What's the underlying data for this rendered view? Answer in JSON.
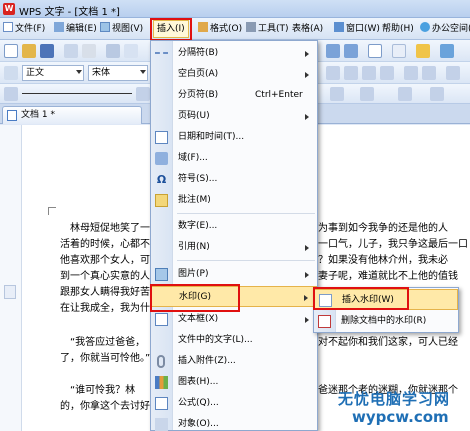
{
  "window": {
    "title": "WPS 文字 - [文档 1 *]"
  },
  "menubar": {
    "items": [
      {
        "label": "文件(F)"
      },
      {
        "label": "编辑(E)"
      },
      {
        "label": "视图(V)"
      },
      {
        "label": "插入(I)"
      },
      {
        "label": "格式(O)"
      },
      {
        "label": "工具(T)"
      },
      {
        "label": "表格(A)"
      },
      {
        "label": "窗口(W)"
      },
      {
        "label": "帮助(H)"
      },
      {
        "label": "办公空间("
      }
    ]
  },
  "toolbar": {
    "style_value": "正文",
    "font_value": "宋体"
  },
  "tabs": {
    "doc_label": "文档 1 *"
  },
  "insert_menu": {
    "items": [
      {
        "label": "分隔符(B)"
      },
      {
        "label": "空白页(A)"
      },
      {
        "label": "分页符(B)",
        "shortcut": "Ctrl+Enter"
      },
      {
        "label": "页码(U)"
      },
      {
        "label": "日期和时间(T)..."
      },
      {
        "label": "域(F)..."
      },
      {
        "label": "符号(S)..."
      },
      {
        "label": "批注(M)"
      },
      {
        "label": "数字(E)..."
      },
      {
        "label": "引用(N)"
      },
      {
        "label": "图片(P)"
      },
      {
        "label": "水印(G)"
      },
      {
        "label": "文本框(X)"
      },
      {
        "label": "文件中的文字(L)..."
      },
      {
        "label": "插入附件(Z)..."
      },
      {
        "label": "图表(H)..."
      },
      {
        "label": "公式(Q)..."
      },
      {
        "label": "对象(O)..."
      }
    ]
  },
  "watermark_submenu": {
    "items": [
      {
        "label": "插入水印(W)"
      },
      {
        "label": "删除文档中的水印(R)"
      }
    ]
  },
  "document": {
    "lines_left": [
      "林母短促地笑了一",
      "活着的时候，心都不",
      "他喜欢那个女人，可",
      "到一个真心实意的人",
      "跟那女人瞒得我好苦",
      "在让我成全，我为什"
    ],
    "lines_right": [
      "为事到如今我争的还是他的人",
      "一口气，儿子，我只争这最后一口",
      "？如果没有他林介州，我未必",
      "妻子呢，难道就比不上他的值钱",
      "",
      ""
    ],
    "para2_left": [
      "“我答应过爸爸，",
      "了，你就当可怜他。”"
    ],
    "para2_right": [
      "对不起你和我们这家，可人已经",
      ""
    ],
    "para3_left": [
      "“谁可怜我？林",
      "的，你拿这个去讨好"
    ],
    "para3_right": [
      "爸迷那个老的迷糊，你就迷那个",
      ""
    ]
  },
  "watermark": {
    "line1": "无忧电脑学习网",
    "line2": "wypcw.com"
  },
  "colors": {
    "highlight": "#e01010",
    "menu_hover": "#ffe9a8",
    "watermark_blue": "#1f6fb5"
  }
}
